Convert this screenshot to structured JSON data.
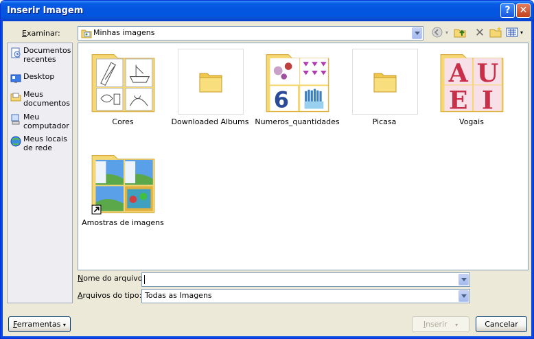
{
  "window": {
    "title": "Inserir Imagem",
    "help_glyph": "?",
    "close_glyph": "✕"
  },
  "lookin": {
    "label_u": "E",
    "label_rest": "xaminar:",
    "value": "Minhas imagens"
  },
  "places": [
    {
      "label": "Documentos recentes",
      "icon": "recent-docs-icon"
    },
    {
      "label": "Desktop",
      "icon": "desktop-icon"
    },
    {
      "label": "Meus documentos",
      "icon": "my-documents-icon"
    },
    {
      "label": "Meu computador",
      "icon": "my-computer-icon"
    },
    {
      "label": "Meus locais de rede",
      "icon": "network-places-icon"
    }
  ],
  "files": [
    {
      "name": "Cores"
    },
    {
      "name": "Downloaded Albums"
    },
    {
      "name": "Numeros_quantidades"
    },
    {
      "name": "Picasa"
    },
    {
      "name": "Vogais"
    },
    {
      "name": "Amostras de imagens"
    }
  ],
  "vogais_letters": [
    "A",
    "U",
    "E",
    "I"
  ],
  "numeros_digit": "6",
  "filename": {
    "label_u": "N",
    "label_rest": "ome do arquivo:",
    "value": ""
  },
  "filetype": {
    "label_u": "A",
    "label_rest": "rquivos do tipo:",
    "value": "Todas as Imagens"
  },
  "buttons": {
    "tools_u": "F",
    "tools_rest": "erramentas",
    "insert_u": "I",
    "insert_rest": "nserir",
    "cancel": "Cancelar"
  },
  "colors": {
    "title_bar": "#0454e0",
    "dialog_bg": "#ece9d8",
    "folder": "#f5d774"
  }
}
